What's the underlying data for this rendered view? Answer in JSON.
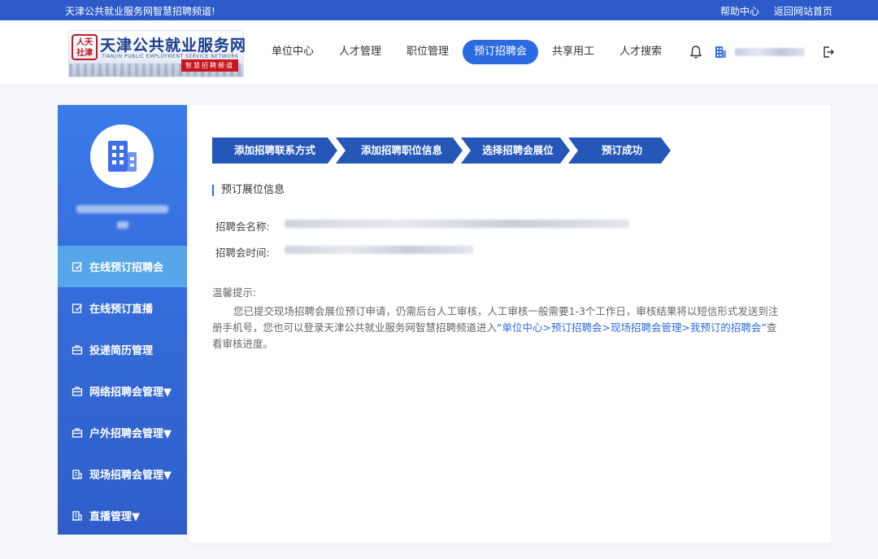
{
  "topbar": {
    "welcome": "天津公共就业服务网智慧招聘频道!",
    "links": [
      "帮助中心",
      "返回网站首页"
    ]
  },
  "logo": {
    "seal_text": "人天社津",
    "name_cn": "天津公共就业服务网",
    "name_en": "TIANJIN PUBLIC EMPLOYMENT SERVICE NETWORK",
    "badge": "智慧招聘频道"
  },
  "nav": {
    "items": [
      "单位中心",
      "人才管理",
      "职位管理",
      "预订招聘会",
      "共享用工",
      "人才搜索"
    ],
    "active_index": 3
  },
  "header_icons": [
    "bell-icon",
    "building-icon",
    "logout-icon"
  ],
  "sidebar": {
    "menu": [
      {
        "label": "在线预订招聘会",
        "icon": "edit-square-icon",
        "active": true
      },
      {
        "label": "在线预订直播",
        "icon": "edit-square-icon",
        "active": false
      },
      {
        "label": "投递简历管理",
        "icon": "briefcase-icon",
        "active": false
      },
      {
        "label": "网络招聘会管理▼",
        "icon": "briefcase-icon",
        "active": false
      },
      {
        "label": "户外招聘会管理▼",
        "icon": "briefcase-icon",
        "active": false
      },
      {
        "label": "现场招聘会管理▼",
        "icon": "office-icon",
        "active": false
      },
      {
        "label": "直播管理▼",
        "icon": "office-icon",
        "active": false
      }
    ]
  },
  "steps": [
    "添加招聘联系方式",
    "添加招聘职位信息",
    "选择招聘会展位",
    "预订成功"
  ],
  "section": {
    "title": "预订展位信息",
    "fair_name_label": "招聘会名称:",
    "fair_time_label": "招聘会时间:"
  },
  "tips": {
    "title": "温馨提示:",
    "text_before": "您已提交现场招聘会展位预订申请，仍需后台人工审核，人工审核一般需要1-3个工作日，审核结果将以短信形式发送到注册手机号，您也可以登录天津公共就业服务网智慧招聘频道进入",
    "link": "“单位中心>预订招聘会>现场招聘会管理>我预订的招聘会”",
    "text_after": "查看审核进度。"
  },
  "colors": {
    "primary": "#2c6ae0",
    "topbar": "#2c5bc9",
    "step": "#2557b8",
    "sidebar_active": "#58a6ea"
  }
}
